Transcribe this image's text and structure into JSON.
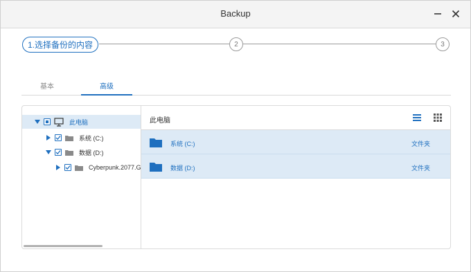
{
  "window": {
    "title": "Backup"
  },
  "stepper": {
    "steps": [
      {
        "label": "1.选择备份的内容"
      },
      {
        "label": "2"
      },
      {
        "label": "3"
      }
    ]
  },
  "tabs": [
    {
      "label": "基本"
    },
    {
      "label": "高级"
    }
  ],
  "tree": {
    "items": [
      {
        "label": "此电脑",
        "icon": "computer-icon",
        "checked": "partial",
        "selected": true
      },
      {
        "label": "系统 (C:)",
        "icon": "folder-icon",
        "checked": true
      },
      {
        "label": "数据 (D:)",
        "icon": "folder-icon",
        "checked": true
      },
      {
        "label": "Cyberpunk.2077.G",
        "icon": "folder-icon",
        "checked": true
      }
    ]
  },
  "content": {
    "breadcrumb": "此电脑",
    "rows": [
      {
        "name": "系统 (C:)",
        "type": "文件夹"
      },
      {
        "name": "数据 (D:)",
        "type": "文件夹"
      }
    ]
  },
  "colors": {
    "accent": "#1e6fbf",
    "selection": "#ddeaf6",
    "border": "#dadada"
  }
}
